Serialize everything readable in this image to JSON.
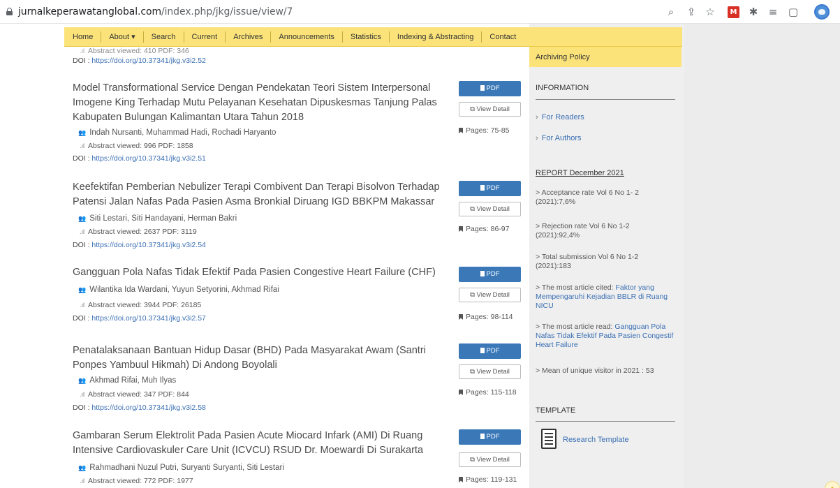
{
  "browser": {
    "url_host": "jurnalkeperawatanglobal.com",
    "url_path": "/index.php/jkg/issue/view/7",
    "icons": [
      "zoom-icon",
      "share-icon",
      "star-icon",
      "extension-red-icon",
      "puzzle-icon",
      "media-list-icon",
      "side-panel-icon",
      "profile-avatar"
    ]
  },
  "nav": {
    "items": [
      "Home",
      "About ▾",
      "Search",
      "Current",
      "Archives",
      "Announcements",
      "Statistics",
      "Indexing & Abstracting",
      "Contact"
    ]
  },
  "top_partial": {
    "stats": "Abstract viewed: 410  PDF: 346",
    "doi_label": "DOI : ",
    "doi": "https://doi.org/10.37341/jkg.v3i2.52"
  },
  "articles": [
    {
      "title": "Model Transformational Service Dengan Pendekatan Teori Sistem Interpersonal Imogene King Terhadap Mutu Pelayanan Kesehatan Dipuskesmas Tanjung Palas Kabupaten Bulungan Kalimantan Utara Tahun 2018",
      "authors": "Indah Nursanti, Muhammad Hadi, Rochadi Haryanto",
      "stats": "Abstract viewed: 996   PDF: 1858",
      "doi_label": "DOI : ",
      "doi": "https://doi.org/10.37341/jkg.v3i2.51",
      "pdf": "PDF",
      "detail": "View Detail",
      "pages": "Pages: 75-85"
    },
    {
      "title": "Keefektifan Pemberian Nebulizer Terapi Combivent Dan Terapi Bisolvon Terhadap Patensi Jalan Nafas Pada Pasien Asma Bronkial Diruang IGD BBKPM Makassar",
      "authors": "Siti Lestari, Siti Handayani, Herman Bakri",
      "stats": "Abstract viewed: 2637   PDF: 3119",
      "doi_label": "DOI : ",
      "doi": "https://doi.org/10.37341/jkg.v3i2.54",
      "pdf": "PDF",
      "detail": "View Detail",
      "pages": "Pages: 86-97"
    },
    {
      "title": "Gangguan Pola Nafas Tidak Efektif Pada Pasien Congestive Heart Failure (CHF)",
      "authors": "Wilantika Ida Wardani, Yuyun Setyorini, Akhmad Rifai",
      "stats": "Abstract viewed: 3944   PDF: 26185",
      "doi_label": "DOI : ",
      "doi": "https://doi.org/10.37341/jkg.v3i2.57",
      "pdf": "PDF",
      "detail": "View Detail",
      "pages": "Pages: 98-114"
    },
    {
      "title": "Penatalaksanaan Bantuan Hidup Dasar (BHD) Pada Masyarakat Awam (Santri Ponpes Yambuul Hikmah) Di Andong Boyolali",
      "authors": "Akhmad Rifai, Muh Ilyas",
      "stats": "Abstract viewed: 347   PDF: 844",
      "doi_label": "DOI : ",
      "doi": "https://doi.org/10.37341/jkg.v3i2.58",
      "pdf": "PDF",
      "detail": "View Detail",
      "pages": "Pages: 115-118"
    },
    {
      "title": "Gambaran Serum Elektrolit Pada Pasien Acute Miocard Infark (AMI) Di Ruang Intensive Cardiovaskuler Care Unit (ICVCU) RSUD Dr. Moewardi Di Surakarta",
      "authors": "Rahmadhani Nuzul Putri, Suryanti Suryanti, Siti Lestari",
      "stats": "Abstract viewed: 772   PDF: 1977",
      "pdf": "PDF",
      "detail": "View Detail",
      "pages": "Pages: 119-131"
    }
  ],
  "sidebar": {
    "archiving": "Archiving Policy",
    "information": "INFORMATION",
    "for_readers": "For Readers",
    "for_authors": "For Authors",
    "report_title": "REPORT December 2021",
    "acceptance": "> Acceptance rate Vol 6 No 1- 2 (2021):7,6%",
    "rejection": "> Rejection rate Vol 6 No 1-2 (2021):92,4%",
    "total": "> Total submission Vol 6 No 1-2 (2021):183",
    "cited_prefix": "> The most article cited: ",
    "cited_link": "Faktor yang Mempengaruhi Kejadian BBLR di Ruang NICU",
    "read_prefix": "> The most article read: ",
    "read_link": "Gangguan Pola Nafas Tidak Efektif Pada Pasien Congestif Heart Failure",
    "visitors": "> Mean of unique visitor in 2021 : 53",
    "template_title": "TEMPLATE",
    "template_link": "Research Template"
  },
  "colors": {
    "nav_yellow": "#fbe37a",
    "button_blue": "#3a78b8",
    "link_blue": "#3a6fb3"
  }
}
